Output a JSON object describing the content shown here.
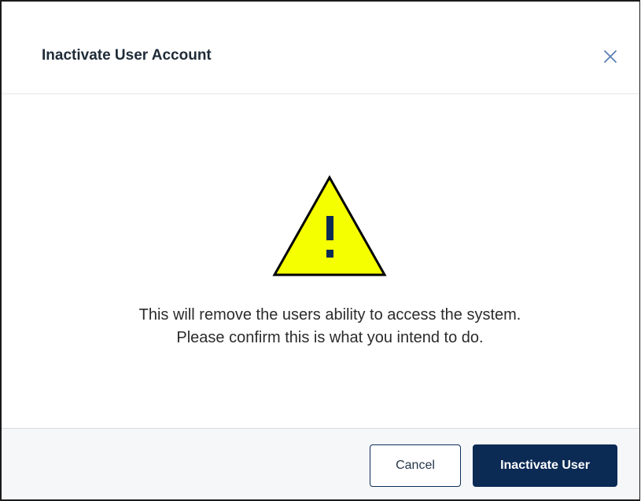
{
  "dialog": {
    "title": "Inactivate User Account",
    "close_icon": "close-icon",
    "warning_icon": "warning-triangle-icon",
    "message_lines": [
      "This will remove the users ability to access the system.",
      "Please confirm this is what you intend to do."
    ]
  },
  "footer": {
    "cancel_label": "Cancel",
    "confirm_label": "Inactivate User"
  },
  "colors": {
    "primary": "#0b2a54",
    "warning_fill": "#f5ff00",
    "warning_mark": "#0b2a54",
    "close_icon": "#5b7fb4",
    "footer_bg": "#f6f7f9"
  }
}
